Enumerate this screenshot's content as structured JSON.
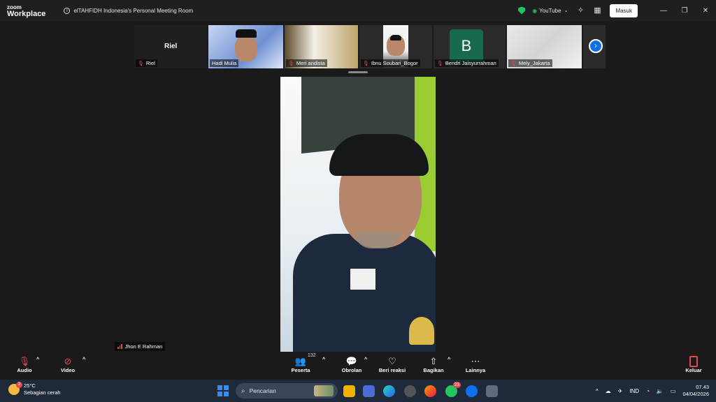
{
  "app": {
    "logo_top": "zoom",
    "logo_bottom": "Workplace",
    "meeting_title": "elTAHFIDH Indonesia's Personal Meeting Room"
  },
  "titlebar": {
    "youtube_label": "YouTube",
    "masuk_label": "Masuk"
  },
  "self_view": {
    "name": "Riel",
    "label": "Riel"
  },
  "participants": [
    {
      "name": "Hadi Mulia",
      "muted": false
    },
    {
      "name": "Meri andista",
      "muted": true
    },
    {
      "name": "Ibnu Soubari_Bogor",
      "muted": true
    },
    {
      "name": "Bendri Jaisyurrahman",
      "muted": true,
      "avatar_letter": "B"
    },
    {
      "name": "Mely_Jakarta",
      "muted": true
    }
  ],
  "main_speaker": {
    "name": "Jhon E Rahman"
  },
  "toolbar": {
    "audio": "Audio",
    "video": "Video",
    "participants": "Peserta",
    "participants_count": "132",
    "chat": "Obrolan",
    "react": "Beri reaksi",
    "share": "Bagikan",
    "more": "Lainnya",
    "leave": "Keluar"
  },
  "taskbar": {
    "weather_temp": "25°C",
    "weather_desc": "Sebagian cerah",
    "weather_badge": "2",
    "search_placeholder": "Pencarian",
    "whatsapp_badge": "23",
    "language": "IND",
    "time": "07.43",
    "date": "04/04/2026"
  },
  "colors": {
    "accent": "#0e71eb",
    "mute_red": "#e5484d",
    "secure_green": "#22c55e"
  }
}
